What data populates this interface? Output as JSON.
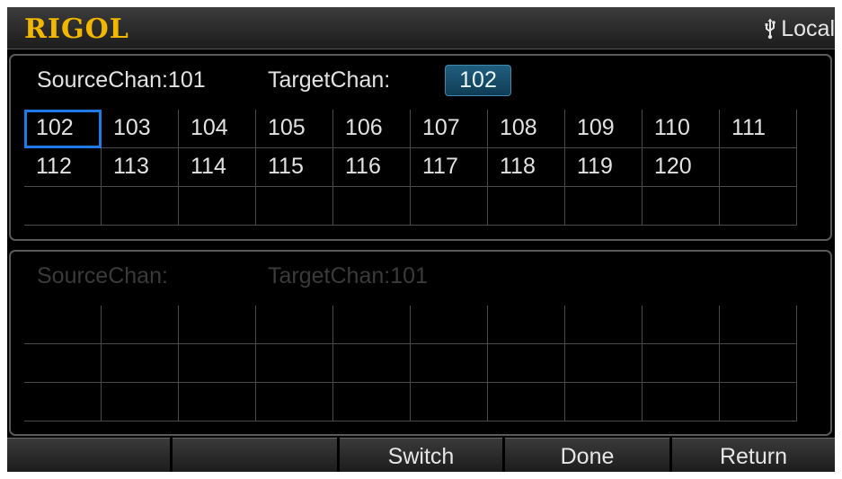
{
  "header": {
    "logo": "RIGOL",
    "status_icon": "usb-icon",
    "status_text": "Local"
  },
  "top_panel": {
    "source_label": "SourceChan:101",
    "target_label": "TargetChan:",
    "target_value": "102",
    "selected_channel": "102",
    "channels": [
      [
        "102",
        "103",
        "104",
        "105",
        "106",
        "107",
        "108",
        "109",
        "110",
        "111"
      ],
      [
        "112",
        "113",
        "114",
        "115",
        "116",
        "117",
        "118",
        "119",
        "120",
        ""
      ],
      [
        "",
        "",
        "",
        "",
        "",
        "",
        "",
        "",
        "",
        ""
      ]
    ]
  },
  "bottom_panel": {
    "source_label": "SourceChan:",
    "target_label": "TargetChan:101",
    "channels": [
      [
        "",
        "",
        "",
        "",
        "",
        "",
        "",
        "",
        "",
        ""
      ],
      [
        "",
        "",
        "",
        "",
        "",
        "",
        "",
        "",
        "",
        ""
      ],
      [
        "",
        "",
        "",
        "",
        "",
        "",
        "",
        "",
        "",
        ""
      ]
    ]
  },
  "softkeys": [
    "",
    "",
    "Switch",
    "Done",
    "Return"
  ],
  "colors": {
    "logo": "#f2b800",
    "selection": "#1e7be6",
    "target_box": "#1f5e7e",
    "dimmed_text": "#3a3a3a"
  }
}
